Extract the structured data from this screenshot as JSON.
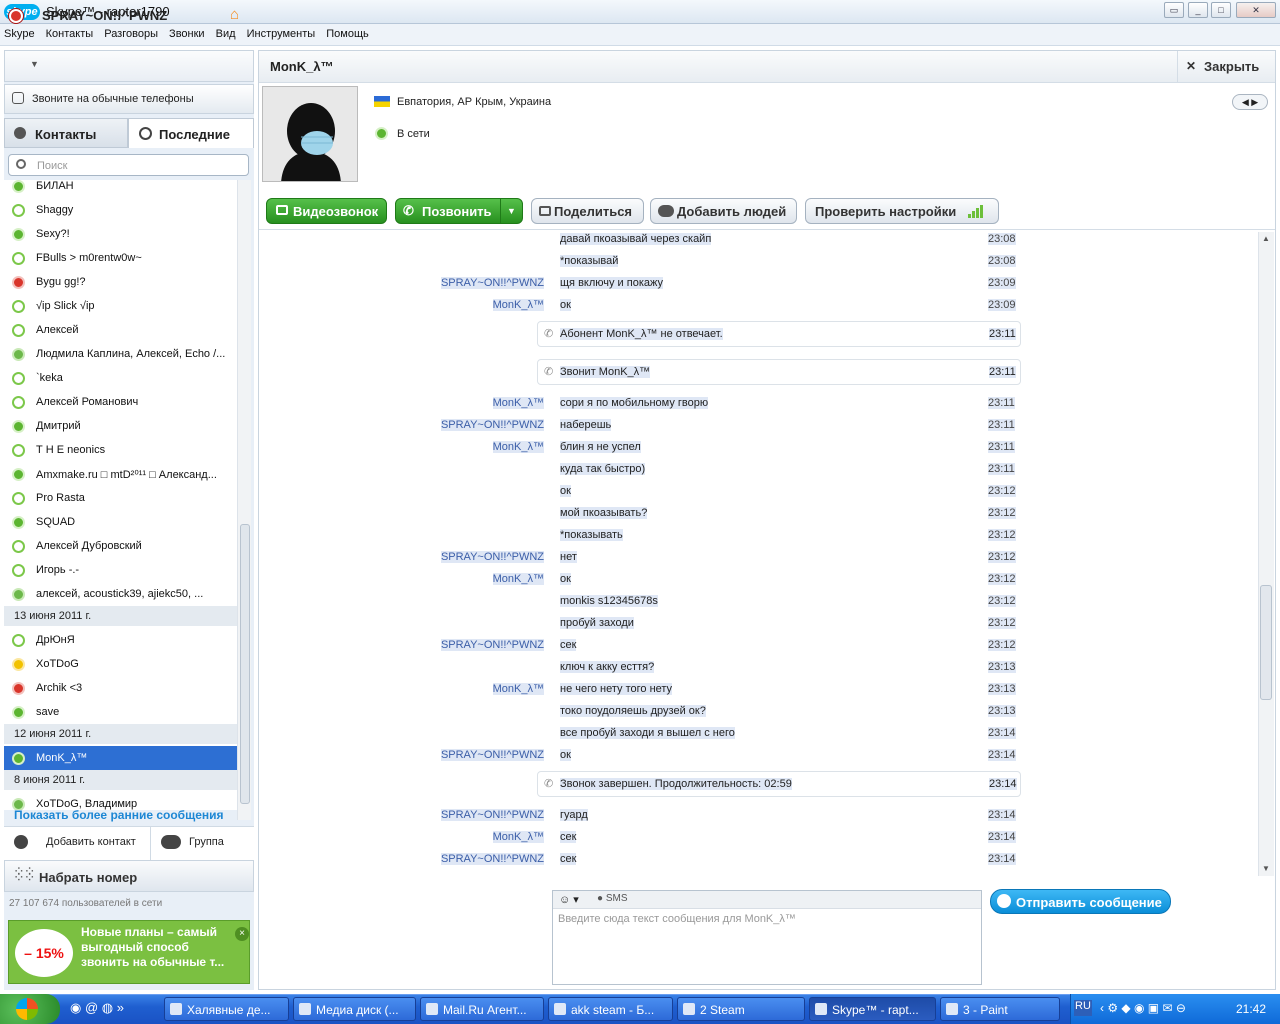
{
  "window": {
    "title": "Skype™ - raptor1790",
    "logo_text": "skype"
  },
  "menu": [
    "Skype",
    "Контакты",
    "Разговоры",
    "Звонки",
    "Вид",
    "Инструменты",
    "Помощь"
  ],
  "profile": {
    "name": "SPRAY~ON!!^PWNZ",
    "call_phones": "Звоните на обычные телефоны"
  },
  "tabs": {
    "contacts": "Контакты",
    "recent": "Последние"
  },
  "search": {
    "placeholder": "Поиск"
  },
  "contacts": [
    {
      "name": "БИЛАН",
      "status": "on"
    },
    {
      "name": "Shaggy",
      "status": "off"
    },
    {
      "name": "Sexy?!",
      "status": "on"
    },
    {
      "name": "FBulls > m0rentw0w~",
      "status": "off"
    },
    {
      "name": "Bygu gg!?",
      "status": "red"
    },
    {
      "name": "√ip Slick √ip",
      "status": "off"
    },
    {
      "name": "Алексей",
      "status": "off"
    },
    {
      "name": "Людмила Каплина, Алексей, Echo /...",
      "status": "grp"
    },
    {
      "name": "`keka",
      "status": "off"
    },
    {
      "name": "Алексей Романович",
      "status": "off"
    },
    {
      "name": "Дмитрий",
      "status": "on"
    },
    {
      "name": "Т Н Е      neonics",
      "status": "off"
    },
    {
      "name": "Amxmake.ru □ mtD²⁰¹¹ □ Александ...",
      "status": "on"
    },
    {
      "name": "Pro Rasta",
      "status": "off"
    },
    {
      "name": "SQUAD",
      "status": "on"
    },
    {
      "name": "Алексей Дубровский",
      "status": "off"
    },
    {
      "name": "Игорь                   -.-",
      "status": "off"
    },
    {
      "name": "алексей, acoustick39, ajiekc50, ...",
      "status": "grp"
    }
  ],
  "dates": {
    "d1": "13 июня 2011 г.",
    "d2": "12 июня 2011 г.",
    "d3": "8 июня 2011 г."
  },
  "contacts2": [
    {
      "name": "ДрЮнЯ",
      "status": "off"
    },
    {
      "name": "XoTDoG",
      "status": "yel"
    },
    {
      "name": "Archik <3",
      "status": "red"
    },
    {
      "name": "save",
      "status": "on"
    }
  ],
  "contacts3": [
    {
      "name": "MonK_λ™",
      "status": "on"
    }
  ],
  "contacts4": [
    {
      "name": "XoTDoG, Владимир",
      "status": "grp"
    }
  ],
  "show_more": "Показать более ранние сообщения",
  "add_contact": "Добавить контакт",
  "group": "Группа",
  "dial": "Набрать номер",
  "users_online": "27 107 674 пользователей в сети",
  "ad": {
    "text": "Новые планы – самый выгодный способ звонить на обычные т...",
    "badge": "– 15%",
    "close": "×"
  },
  "chat_header": {
    "name": "MonK_λ™",
    "close": "Закрыть",
    "location": "Евпатория, АР Крым, Украина",
    "status": "В сети"
  },
  "toolbar": {
    "video": "Видеозвонок",
    "call": "Позвонить",
    "share": "Поделиться",
    "add_people": "Добавить людей",
    "check": "Проверить настройки"
  },
  "messages": [
    {
      "who": "",
      "text": "давай пкоазывай через скайп",
      "time": "23:08"
    },
    {
      "who": "",
      "text": "*показывай",
      "time": "23:08"
    },
    {
      "who": "SPRAY~ON!!^PWNZ",
      "text": "щя включу и покажу",
      "time": "23:09"
    },
    {
      "who": "MonK_λ™",
      "text": "ок",
      "time": "23:09"
    }
  ],
  "sys1": {
    "text": "Абонент MonK_λ™ не отвечает.",
    "time": "23:11"
  },
  "sys2": {
    "text": "Звонит MonK_λ™",
    "time": "23:11"
  },
  "messages2": [
    {
      "who": "MonK_λ™",
      "text": "сори я по мобильному гворю",
      "time": "23:11"
    },
    {
      "who": "SPRAY~ON!!^PWNZ",
      "text": "наберешь",
      "time": "23:11"
    },
    {
      "who": "MonK_λ™",
      "text": "блин я не успел",
      "time": "23:11"
    },
    {
      "who": "",
      "text": "куда так быстро)",
      "time": "23:11"
    },
    {
      "who": "",
      "text": "ок",
      "time": "23:12"
    },
    {
      "who": "",
      "text": "мой пкоазывать?",
      "time": "23:12"
    },
    {
      "who": "",
      "text": "*показывать",
      "time": "23:12"
    },
    {
      "who": "SPRAY~ON!!^PWNZ",
      "text": "нет",
      "time": "23:12"
    },
    {
      "who": "MonK_λ™",
      "text": "ок",
      "time": "23:12"
    },
    {
      "who": "",
      "text": "monkis    s12345678s",
      "time": "23:12"
    },
    {
      "who": "",
      "text": "пробуй заходи",
      "time": "23:12"
    },
    {
      "who": "SPRAY~ON!!^PWNZ",
      "text": "сек",
      "time": "23:12"
    },
    {
      "who": "",
      "text": "ключ к акку есття?",
      "time": "23:13"
    },
    {
      "who": "MonK_λ™",
      "text": "не чего нету того нету",
      "time": "23:13"
    },
    {
      "who": "",
      "text": "токо поудоляешь друзей ок?",
      "time": "23:13"
    },
    {
      "who": "",
      "text": "все пробуй заходи я вышел с него",
      "time": "23:14"
    },
    {
      "who": "SPRAY~ON!!^PWNZ",
      "text": "ок",
      "time": "23:14"
    }
  ],
  "sys3": {
    "text": "Звонок завершен. Продолжительность: 02:59",
    "time": "23:14"
  },
  "messages3": [
    {
      "who": "SPRAY~ON!!^PWNZ",
      "text": "гуард",
      "time": "23:14"
    },
    {
      "who": "MonK_λ™",
      "text": "сек",
      "time": "23:14"
    },
    {
      "who": "SPRAY~ON!!^PWNZ",
      "text": "сек",
      "time": "23:14"
    }
  ],
  "input": {
    "placeholder": "Введите сюда текст сообщения для MonK_λ™",
    "sms": "SMS",
    "send": "Отправить сообщение"
  },
  "taskbar": {
    "items": [
      "Халявные де...",
      "Медиа диск (...",
      "Mail.Ru Агент...",
      "akk steam - Б...",
      "2 Steam",
      "Skype™ - rapt...",
      "3 - Paint"
    ],
    "lang": "RU",
    "clock": "21:42"
  }
}
